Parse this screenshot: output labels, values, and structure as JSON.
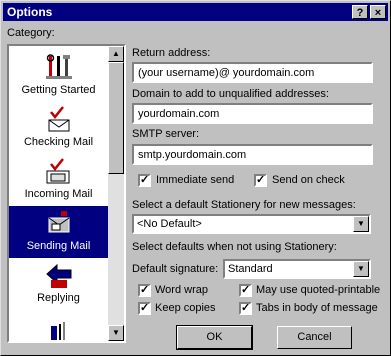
{
  "window": {
    "title": "Options",
    "help_label": "?",
    "close_label": "×"
  },
  "category": {
    "label": "Category:",
    "items": [
      {
        "name": "Getting Started",
        "icon": "tools-icon"
      },
      {
        "name": "Checking Mail",
        "icon": "check-mail-icon"
      },
      {
        "name": "Incoming Mail",
        "icon": "incoming-mail-icon"
      },
      {
        "name": "Sending Mail",
        "icon": "sending-mail-icon",
        "selected": true
      },
      {
        "name": "Replying",
        "icon": "reply-icon"
      },
      {
        "name": "",
        "icon": "partial-icon"
      }
    ]
  },
  "form": {
    "return_address_label": "Return address:",
    "return_address_value": "(your username)@ yourdomain.com",
    "domain_label": "Domain to add to unqualified addresses:",
    "domain_value": "yourdomain.com",
    "smtp_label": "SMTP server:",
    "smtp_value": "smtp.yourdomain.com",
    "immediate_send": {
      "label": "Immediate send",
      "checked": true
    },
    "send_on_check": {
      "label": "Send on check",
      "checked": true
    },
    "stationery_label": "Select a default Stationery for new messages:",
    "stationery_value": "<No Default>",
    "no_stationery_label": "Select defaults when not using Stationery:",
    "signature_label": "Default signature:",
    "signature_value": "Standard",
    "word_wrap": {
      "label": "Word wrap",
      "checked": true
    },
    "quoted_printable": {
      "label": "May use quoted-printable",
      "checked": true
    },
    "keep_copies": {
      "label": "Keep copies",
      "checked": true
    },
    "tabs_in_body": {
      "label": "Tabs in body of message",
      "checked": true
    }
  },
  "buttons": {
    "ok": "OK",
    "cancel": "Cancel"
  },
  "colors": {
    "titlebar": "#000080",
    "selection": "#000080",
    "checkmark_red": "#c00000"
  }
}
